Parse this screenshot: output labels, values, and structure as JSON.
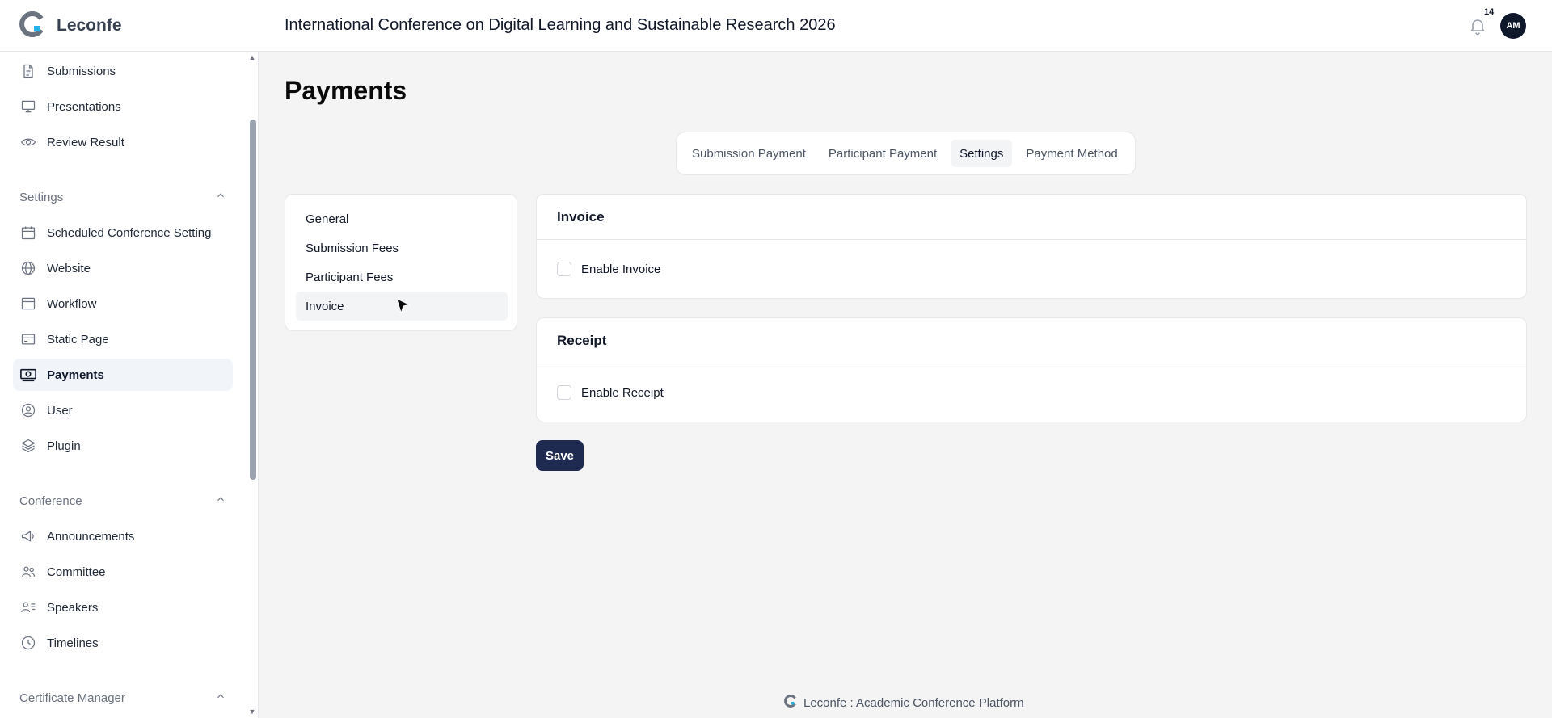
{
  "brand": {
    "name": "Leconfe",
    "logo_icon": "leconfe-logo-icon",
    "accent": "#22b5e6"
  },
  "header": {
    "conference_title": "International Conference on Digital Learning and Sustainable Research 2026",
    "notification_count": "14",
    "avatar_initials": "AM"
  },
  "sidebar": {
    "top_items": [
      {
        "label": "Submissions",
        "icon": "document-icon"
      },
      {
        "label": "Presentations",
        "icon": "presentation-icon"
      },
      {
        "label": "Review Result",
        "icon": "eye-icon"
      }
    ],
    "settings_group": {
      "title": "Settings",
      "items": [
        {
          "label": "Scheduled Conference Setting",
          "icon": "calendar-icon"
        },
        {
          "label": "Website",
          "icon": "globe-icon"
        },
        {
          "label": "Workflow",
          "icon": "window-icon"
        },
        {
          "label": "Static Page",
          "icon": "card-icon"
        },
        {
          "label": "Payments",
          "icon": "cash-icon",
          "active": true
        },
        {
          "label": "User",
          "icon": "user-circle-icon"
        },
        {
          "label": "Plugin",
          "icon": "layers-icon"
        }
      ]
    },
    "conference_group": {
      "title": "Conference",
      "items": [
        {
          "label": "Announcements",
          "icon": "megaphone-icon"
        },
        {
          "label": "Committee",
          "icon": "users-icon"
        },
        {
          "label": "Speakers",
          "icon": "speakers-icon"
        },
        {
          "label": "Timelines",
          "icon": "clock-icon"
        }
      ]
    },
    "certificate_group": {
      "title": "Certificate Manager"
    }
  },
  "main": {
    "page_title": "Payments",
    "tabs": [
      {
        "label": "Submission Payment"
      },
      {
        "label": "Participant Payment"
      },
      {
        "label": "Settings",
        "active": true
      },
      {
        "label": "Payment Method"
      }
    ],
    "subnav": [
      {
        "label": "General"
      },
      {
        "label": "Submission Fees"
      },
      {
        "label": "Participant Fees"
      },
      {
        "label": "Invoice",
        "active": true
      }
    ],
    "invoice_card": {
      "title": "Invoice",
      "checkbox_label": "Enable Invoice",
      "checked": false
    },
    "receipt_card": {
      "title": "Receipt",
      "checkbox_label": "Enable Receipt",
      "checked": false
    },
    "save_label": "Save"
  },
  "footer": {
    "text": "Leconfe : Academic Conference Platform"
  }
}
